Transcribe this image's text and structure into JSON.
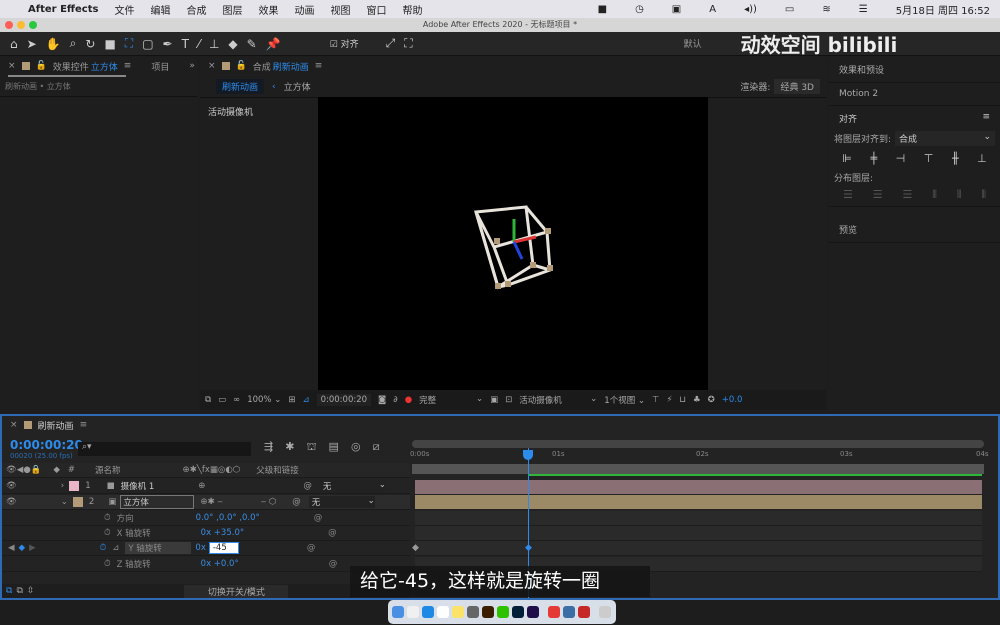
{
  "menubar": {
    "app": "After Effects",
    "items": [
      "文件",
      "编辑",
      "合成",
      "图层",
      "效果",
      "动画",
      "视图",
      "窗口",
      "帮助"
    ],
    "datetime": "5月18日 周四 16:52"
  },
  "window": {
    "title": "Adobe After Effects 2020 - 无标题项目 *"
  },
  "toolbar": {
    "align_label": "对齐",
    "workspace": "默认",
    "watermark": "动效空间 bilibili"
  },
  "left_panel": {
    "tab_prefix": "效果控件",
    "tab_layer": "立方体",
    "tab_project": "项目",
    "breadcrumb": "刷新动画 • 立方体"
  },
  "comp_panel": {
    "tab_prefix": "合成",
    "tab_name": "刷新动画",
    "crumb_active": "刷新动画",
    "crumb_child": "立方体",
    "renderer_label": "渲染器:",
    "renderer_value": "经典 3D",
    "camera_label": "活动摄像机"
  },
  "viewer_bar": {
    "zoom": "100%",
    "timecode": "0:00:00:20",
    "quality": "完整",
    "camera": "活动摄像机",
    "views": "1个视图",
    "exposure": "+0.0"
  },
  "right_panel": {
    "effects": "效果和预设",
    "motion": "Motion 2",
    "align": "对齐",
    "align_to_label": "将图层对齐到:",
    "align_to_value": "合成",
    "distribute": "分布图层:",
    "preview": "预览"
  },
  "timeline": {
    "comp_name": "刷新动画",
    "timecode": "0:00:00:20",
    "frame_info": "00020 (25.00 fps)",
    "col_num": "#",
    "col_source": "源名称",
    "col_parent": "父级和链接",
    "layers": [
      {
        "num": "1",
        "name": "摄像机 1",
        "parent": "无",
        "color": "#e8b4c8"
      },
      {
        "num": "2",
        "name": "立方体",
        "parent": "无",
        "color": "#b39b78"
      }
    ],
    "properties": [
      {
        "name": "方向",
        "value": "0.0° ,0.0° ,0.0°"
      },
      {
        "name": "X 轴旋转",
        "value": "0x +35.0°"
      },
      {
        "name": "Y 轴旋转",
        "value_prefix": "0x",
        "value_input": "-45"
      },
      {
        "name": "Z 轴旋转",
        "value": "0x +0.0°"
      }
    ],
    "ruler_labels": [
      "0:00s",
      "01s",
      "02s",
      "03s",
      "04s"
    ],
    "toggle_label": "切换开关/模式"
  },
  "subtitle": "给它-45，这样就是旋转一圈",
  "colors": {
    "accent": "#2d8ceb",
    "work_area": "#2fb53a",
    "camera_bar": "#8a6f75",
    "solid_bar": "#9c8a66"
  }
}
